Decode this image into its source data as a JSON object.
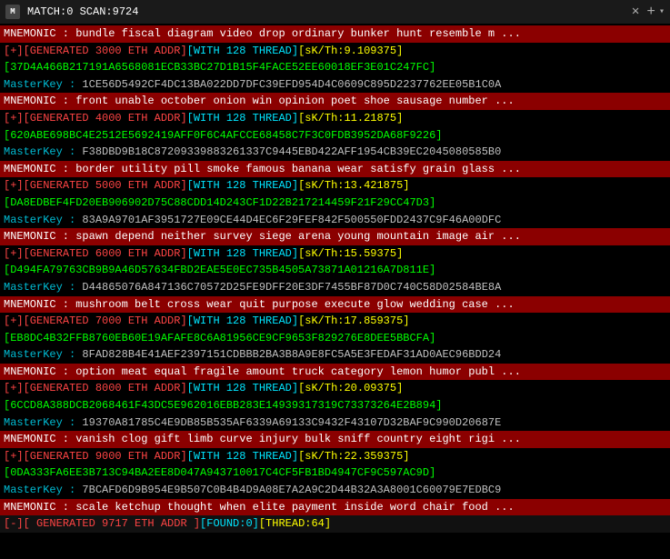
{
  "titlebar": {
    "icon": "M",
    "title": "MATCH:0 SCAN:9724",
    "close": "✕",
    "plus": "+",
    "dropdown": "▾"
  },
  "lines": [
    {
      "type": "mnemonic",
      "text": "MNEMONIC : bundle fiscal diagram video drop ordinary bunker hunt resemble m ..."
    },
    {
      "type": "generated",
      "text": "[+][GENERATED 3000 ETH ADDR][WITH 128 THREAD][sK/Th:9.109375]"
    },
    {
      "type": "addr",
      "text": "[37D4A466B217191A6568081ECB33BC27D1B15F4FACE52EE60018EF3E01C247FC]"
    },
    {
      "type": "masterkey",
      "text": "MasterKey :  1CE56D5492CF4DC13BA022DD7DFC39EFD954D4C0609C895D2237762EE05B1C0A"
    },
    {
      "type": "mnemonic",
      "text": "MNEMONIC : front unable october onion win opinion poet shoe sausage number ..."
    },
    {
      "type": "generated",
      "text": "[+][GENERATED 4000 ETH ADDR][WITH 128 THREAD][sK/Th:11.21875]"
    },
    {
      "type": "addr",
      "text": "[620ABE698BC4E2512E5692419AFF0F6C4AFCCE68458C7F3C0FDB3952DA68F9226]"
    },
    {
      "type": "masterkey",
      "text": "MasterKey :  F38DBD9B18C87209339883261337C9445EBD422AFF1954CB39EC2045080585B0"
    },
    {
      "type": "mnemonic",
      "text": "MNEMONIC : border utility pill smoke famous banana wear satisfy grain glass ..."
    },
    {
      "type": "generated",
      "text": "[+][GENERATED 5000 ETH ADDR][WITH 128 THREAD][sK/Th:13.421875]"
    },
    {
      "type": "addr",
      "text": "[DA8EDBEF4FD20EB906902D75C88CDD14D243CF1D22B217214459F21F29CC47D3]"
    },
    {
      "type": "masterkey",
      "text": "MasterKey :  83A9A9701AF3951727E09CE44D4EC6F29FEF842F500550FDD2437C9F46A00DFC"
    },
    {
      "type": "mnemonic",
      "text": "MNEMONIC : spawn depend neither survey siege arena young mountain image air ..."
    },
    {
      "type": "generated",
      "text": "[+][GENERATED 6000 ETH ADDR][WITH 128 THREAD][sK/Th:15.59375]"
    },
    {
      "type": "addr",
      "text": "[D494FA79763CB9B9A46D57634FBD2EAE5E0EC735B4505A73871A01216A7D811E]"
    },
    {
      "type": "masterkey",
      "text": "MasterKey :  D44865076A847136C70572D25FE9DFF20E3DF7455BF87D0C740C58D02584BE8A"
    },
    {
      "type": "mnemonic",
      "text": "MNEMONIC : mushroom belt cross wear quit purpose execute glow wedding case ..."
    },
    {
      "type": "generated",
      "text": "[+][GENERATED 7000 ETH ADDR][WITH 128 THREAD][sK/Th:17.859375]"
    },
    {
      "type": "addr",
      "text": "[EB8DC4B32FFB8760EB60E19AFAFE8C6A81956CE9CF9653F829276E8DEE5BBCFA]"
    },
    {
      "type": "masterkey",
      "text": "MasterKey :  8FAD828B4E41AEF2397151CDBBB2BA3B8A9E8FC5A5E3FEDAF31AD0AEC96BDD24"
    },
    {
      "type": "mnemonic",
      "text": "MNEMONIC : option meat equal fragile amount truck category lemon humor publ ..."
    },
    {
      "type": "generated",
      "text": "[+][GENERATED 8000 ETH ADDR][WITH 128 THREAD][sK/Th:20.09375]"
    },
    {
      "type": "addr",
      "text": "[6CCD8A388DCB2068461F43DC5E962016EBB283E14939317319C73373264E2B894]"
    },
    {
      "type": "masterkey",
      "text": "MasterKey :  19370A81785C4E9DB85B535AF6339A69133C9432F43107D32BAF9C990D20687E"
    },
    {
      "type": "mnemonic",
      "text": "MNEMONIC : vanish clog gift limb curve injury bulk sniff country eight rigi ..."
    },
    {
      "type": "generated",
      "text": "[+][GENERATED 9000 ETH ADDR][WITH 128 THREAD][sK/Th:22.359375]"
    },
    {
      "type": "addr",
      "text": "[0DA333FA6EE3B713C94BA2EE8D047A943710017C4CF5FB1BD4947CF9C597AC9D]"
    },
    {
      "type": "masterkey",
      "text": "MasterKey :  7BCAFD6D9B954E9B507C0B4B4D9A08E7A2A9C2D44B32A3A8001C60079E7EDBC9"
    },
    {
      "type": "mnemonic",
      "text": "MNEMONIC : scale ketchup thought when elite payment inside word chair food ..."
    },
    {
      "type": "status",
      "text": "[-][ GENERATED 9717 ETH ADDR ][FOUND:0][THREAD:64]"
    }
  ]
}
